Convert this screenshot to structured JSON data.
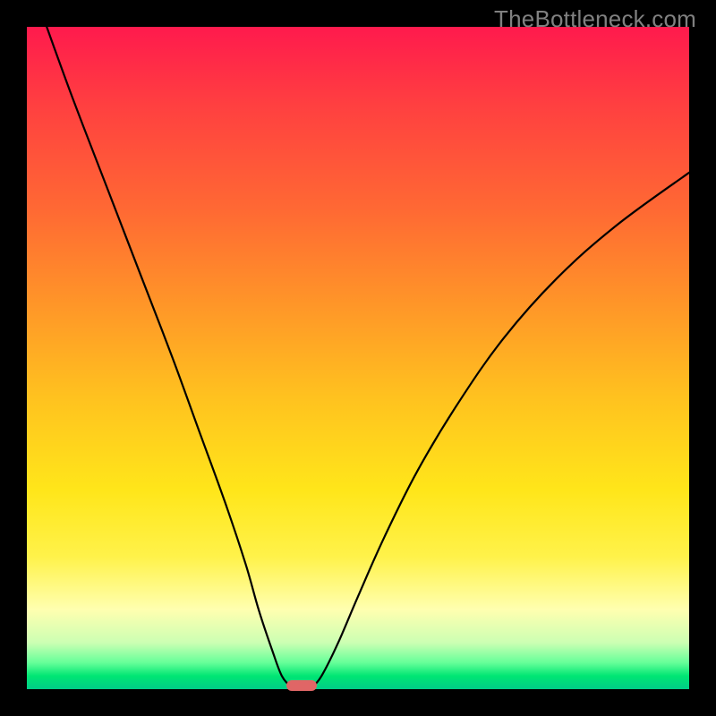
{
  "watermark": "TheBottleneck.com",
  "chart_data": {
    "type": "line",
    "title": "",
    "xlabel": "",
    "ylabel": "",
    "xlim": [
      0,
      100
    ],
    "ylim": [
      0,
      100
    ],
    "gradient_stops": [
      {
        "pos": 0,
        "color": "#ff1a4d"
      },
      {
        "pos": 12,
        "color": "#ff4040"
      },
      {
        "pos": 28,
        "color": "#ff6a33"
      },
      {
        "pos": 42,
        "color": "#ff9628"
      },
      {
        "pos": 56,
        "color": "#ffc21f"
      },
      {
        "pos": 70,
        "color": "#ffe61a"
      },
      {
        "pos": 80,
        "color": "#fff24a"
      },
      {
        "pos": 88,
        "color": "#ffffb0"
      },
      {
        "pos": 93,
        "color": "#ccffb3"
      },
      {
        "pos": 96,
        "color": "#66ff99"
      },
      {
        "pos": 98,
        "color": "#00e673"
      },
      {
        "pos": 100,
        "color": "#00cc88"
      }
    ],
    "curve_left": [
      {
        "x": 3,
        "y": 100
      },
      {
        "x": 7,
        "y": 89
      },
      {
        "x": 12,
        "y": 76
      },
      {
        "x": 17,
        "y": 63
      },
      {
        "x": 22,
        "y": 50
      },
      {
        "x": 26,
        "y": 39
      },
      {
        "x": 30,
        "y": 28
      },
      {
        "x": 33,
        "y": 19
      },
      {
        "x": 35,
        "y": 12
      },
      {
        "x": 37,
        "y": 6
      },
      {
        "x": 38.5,
        "y": 2
      },
      {
        "x": 40,
        "y": 0.2
      }
    ],
    "curve_right": [
      {
        "x": 43,
        "y": 0.2
      },
      {
        "x": 44.5,
        "y": 2
      },
      {
        "x": 47,
        "y": 7
      },
      {
        "x": 50,
        "y": 14
      },
      {
        "x": 54,
        "y": 23
      },
      {
        "x": 59,
        "y": 33
      },
      {
        "x": 65,
        "y": 43
      },
      {
        "x": 72,
        "y": 53
      },
      {
        "x": 80,
        "y": 62
      },
      {
        "x": 89,
        "y": 70
      },
      {
        "x": 100,
        "y": 78
      }
    ],
    "marker": {
      "x": 41.5,
      "y": 0.6,
      "color": "#e06666"
    }
  }
}
